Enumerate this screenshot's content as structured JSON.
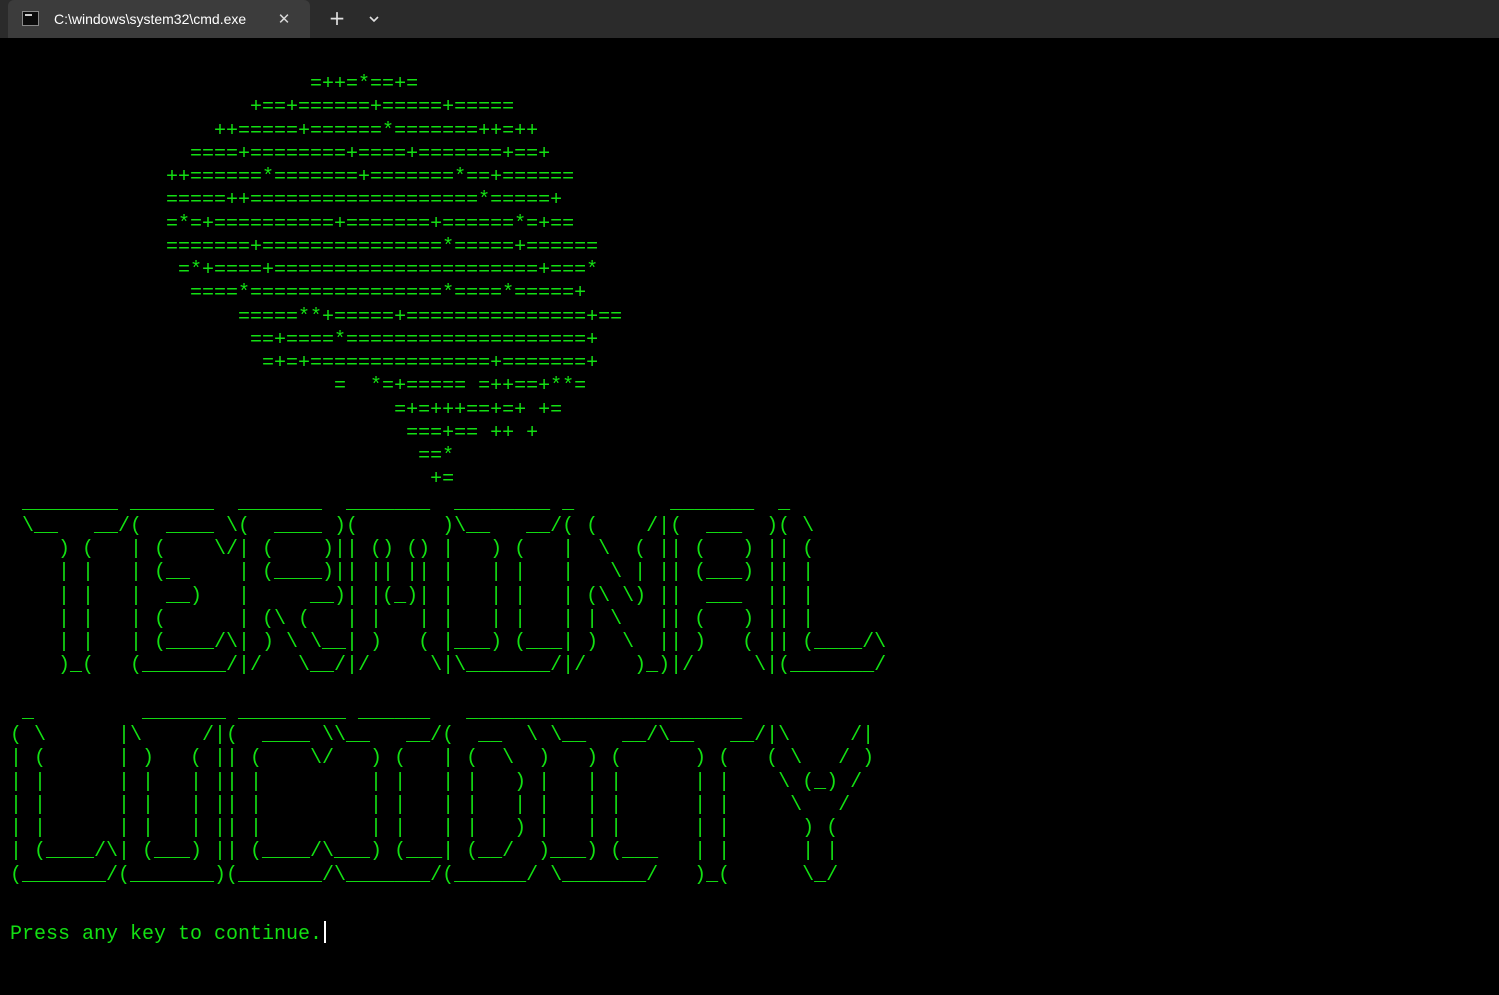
{
  "window": {
    "tab_title": "C:\\windows\\system32\\cmd.exe",
    "tab_close_glyph": "✕",
    "new_tab_glyph": "+",
    "text_color": "#13e013",
    "background": "#000000"
  },
  "console": {
    "art_lines": [
      "                         =++=*==+=",
      "                    +==+======+=====+=====",
      "                 ++=====+======*=======++=++",
      "               ====+========+====+=======+==+",
      "             ++======*=======+=======*==+======",
      "             =====++===================*=====+",
      "             =*=+==========+=======+======*=+==",
      "             =======+===============*=====+======",
      "              =*+====+======================+===*",
      "               ====*================*====*=====+",
      "                   =====**+=====+===============+==",
      "                    ==+====*====================+",
      "                     =+=+===============+=======+",
      "                           =  *=+===== =++==+**=",
      "                                =+=+++==+=+ +=",
      "                                 ===+== ++ +",
      "                                  ==*",
      "                                   +=",
      " ________ _______  _______  _______  ________ _        _______  _",
      " \\__   __/(  ____ \\(  ____ )(       )\\__   __/( (    /|(  ___  )( \\",
      "    ) (   | (    \\/| (    )|| () () |   ) (   |  \\  ( || (   ) || (",
      "    | |   | (__    | (____)|| || || |   | |   |   \\ | || (___) || |",
      "    | |   |  __)   |     __)| |(_)| |   | |   | (\\ \\) ||  ___  || |",
      "    | |   | (      | (\\ (   | |   | |   | |   | | \\   || (   ) || |",
      "    | |   | (____/\\| ) \\ \\__| )   ( |___) (___| )  \\  || )   ( || (____/\\",
      "    )_(   (_______/|/   \\__/|/     \\|\\_______/|/    )_)|/     \\|(_______/",
      "",
      " _         _______ _________ ______   _______________________",
      "( \\      |\\     /|(  ____ \\\\__   __/(  __  \\ \\__   __/\\__   __/|\\     /|",
      "| (      | )   ( || (    \\/   ) (   | (  \\  )   ) (      ) (   ( \\   / )",
      "| |      | |   | || |         | |   | |   ) |   | |      | |    \\ (_) /",
      "| |      | |   | || |         | |   | |   | |   | |      | |     \\   /",
      "| |      | |   | || |         | |   | |   ) |   | |      | |      ) (",
      "| (____/\\| (___) || (____/\\___) (___| (__/  )___) (___   | |      | |",
      "(_______/(_______)(_______/\\_______/(______/ \\_______/   )_(      \\_/"
    ],
    "prompt": "Press any key to continue."
  }
}
